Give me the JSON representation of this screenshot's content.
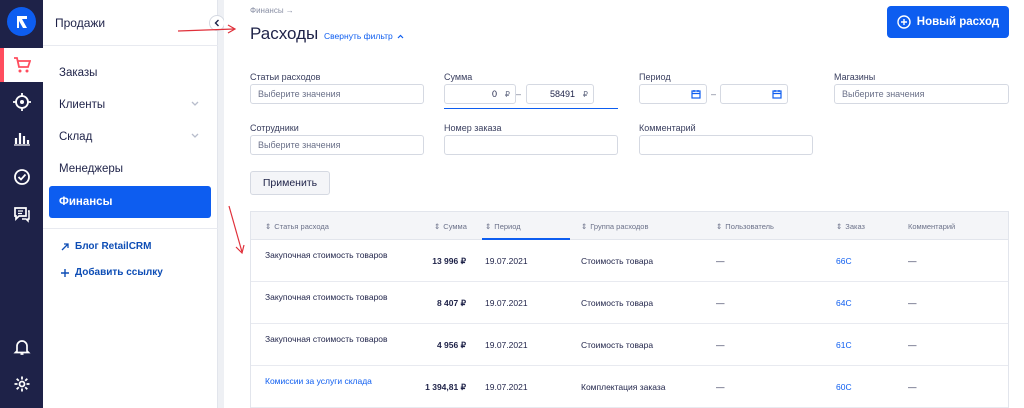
{
  "sidebar": {
    "section_title": "Продажи",
    "items": [
      {
        "label": "Заказы"
      },
      {
        "label": "Клиенты"
      },
      {
        "label": "Склад"
      },
      {
        "label": "Менеджеры"
      },
      {
        "label": "Финансы"
      }
    ],
    "links": [
      {
        "label": "Блог RetailCRM"
      },
      {
        "label": "Добавить ссылку"
      }
    ]
  },
  "header": {
    "breadcrumb": "Финансы →",
    "title": "Расходы",
    "toggle_filter": "Свернуть фильтр",
    "new_button": "Новый расход"
  },
  "filters": {
    "expense_items": {
      "label": "Статьи расходов",
      "placeholder": "Выберите значения"
    },
    "sum": {
      "label": "Сумма",
      "from": "0",
      "to": "58491",
      "currency": "₽",
      "separator": "–"
    },
    "period": {
      "label": "Период",
      "separator": "–"
    },
    "stores": {
      "label": "Магазины",
      "placeholder": "Выберите значения"
    },
    "employees": {
      "label": "Сотрудники",
      "placeholder": "Выберите значения"
    },
    "order_number": {
      "label": "Номер заказа"
    },
    "comment": {
      "label": "Комментарий"
    },
    "apply_button": "Применить"
  },
  "table": {
    "columns": [
      "Статья расхода",
      "Сумма",
      "Период",
      "Группа расходов",
      "Пользователь",
      "Заказ",
      "Комментарий"
    ],
    "rows": [
      {
        "name": "Закупочная стоимость товаров",
        "sum": "13 996 ₽",
        "period": "19.07.2021",
        "group": "Стоимость товара",
        "user": "—",
        "order": "66C",
        "comment": "—"
      },
      {
        "name": "Закупочная стоимость товаров",
        "sum": "8 407 ₽",
        "period": "19.07.2021",
        "group": "Стоимость товара",
        "user": "—",
        "order": "64C",
        "comment": "—"
      },
      {
        "name": "Закупочная стоимость товаров",
        "sum": "4 956 ₽",
        "period": "19.07.2021",
        "group": "Стоимость товара",
        "user": "—",
        "order": "61C",
        "comment": "—"
      },
      {
        "name": "Комиссии за услуги склада",
        "sum": "1 394,81 ₽",
        "period": "19.07.2021",
        "group": "Комплектация заказа",
        "user": "—",
        "order": "60C",
        "comment": "—"
      }
    ]
  },
  "colors": {
    "rail": "#1e2248",
    "accent": "#0d5df0",
    "active_marker": "#ff4d5e",
    "annotation_arrow": "#e0303a"
  }
}
